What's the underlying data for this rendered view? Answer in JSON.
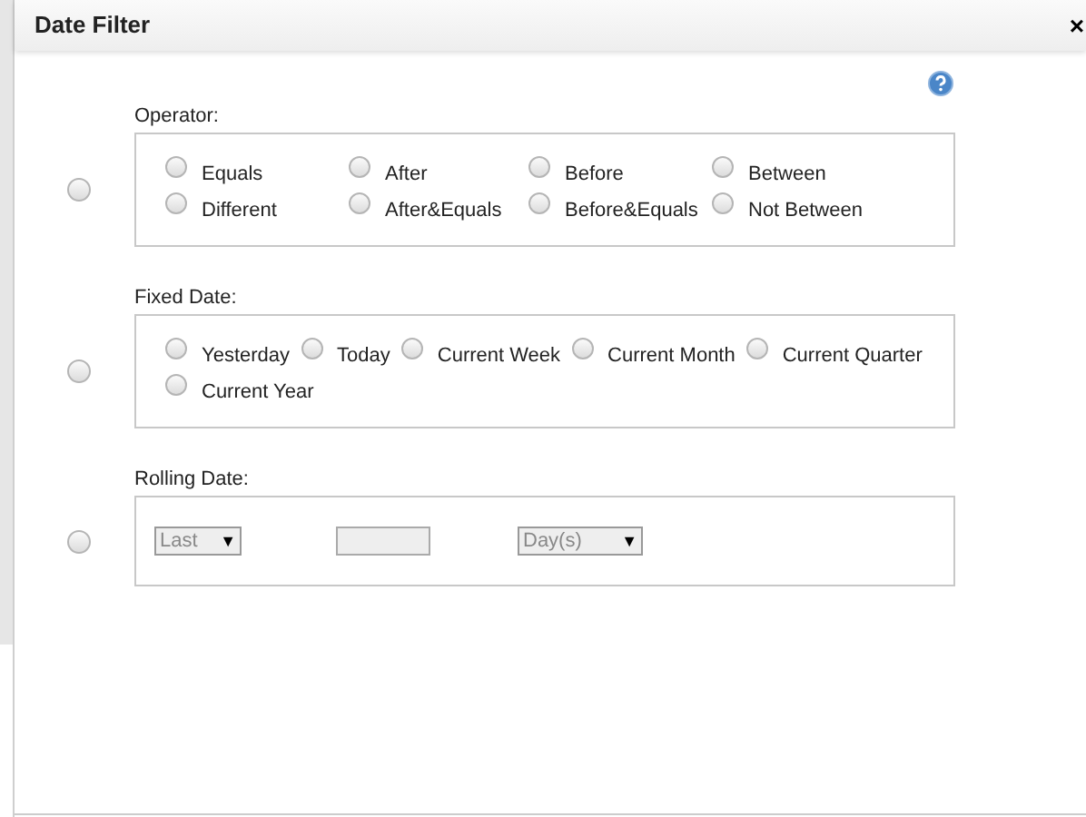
{
  "dialog": {
    "title": "Date Filter",
    "close": "×"
  },
  "sections": [
    {
      "kind": "operator",
      "label": "Operator:",
      "selected": false,
      "options": [
        {
          "label": "Equals",
          "selected": false
        },
        {
          "label": "After",
          "selected": false
        },
        {
          "label": "Before",
          "selected": false
        },
        {
          "label": "Between",
          "selected": false
        },
        {
          "label": "Different",
          "selected": false
        },
        {
          "label": "After&Equals",
          "selected": false
        },
        {
          "label": "Before&Equals",
          "selected": false
        },
        {
          "label": "Not Between",
          "selected": false
        }
      ]
    },
    {
      "kind": "fixed",
      "label": "Fixed Date:",
      "selected": false,
      "options": [
        {
          "label": "Yesterday",
          "selected": false
        },
        {
          "label": "Today",
          "selected": false
        },
        {
          "label": "Current Week",
          "selected": false
        },
        {
          "label": "Current Month",
          "selected": false
        },
        {
          "label": "Current Quarter",
          "selected": false
        },
        {
          "label": "Current Year",
          "selected": false
        }
      ]
    },
    {
      "kind": "rolling",
      "label": "Rolling Date:",
      "selected": false,
      "direction": {
        "value": "Last",
        "arrow": "▼",
        "disabled": true
      },
      "amount": {
        "disabled": true
      },
      "unit": {
        "value": "Day(s)",
        "arrow": "▼",
        "disabled": true
      }
    }
  ]
}
